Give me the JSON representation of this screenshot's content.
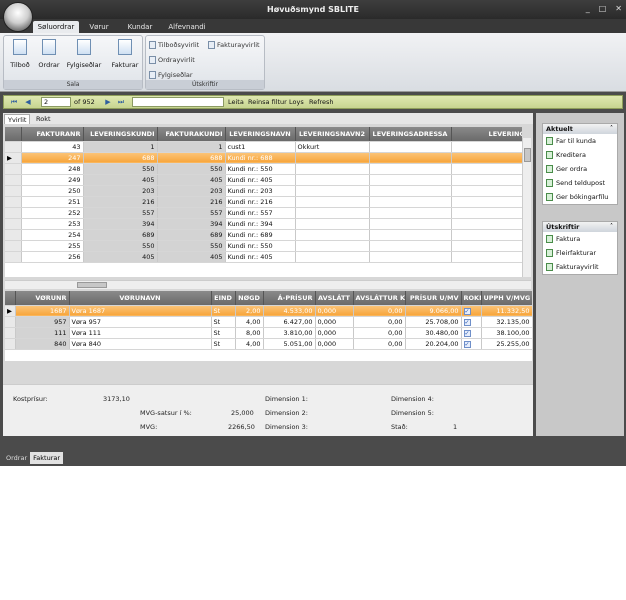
{
  "app": {
    "title": "Høvuðsmynd SBLITE",
    "window_buttons": [
      "_",
      "□",
      "✕"
    ]
  },
  "ribbon": {
    "tabs": [
      "Søluordrar",
      "Vørur",
      "Kundar",
      "Alfevnandi"
    ],
    "groups": {
      "sala": {
        "label": "Sala",
        "buttons": [
          "Tilboð",
          "Ordrar",
          "Fylgiseðlar",
          "Fakturar"
        ]
      },
      "utskriftir": {
        "label": "Útskriftir",
        "buttons": [
          "Tilboðsyvirlit",
          "Fakturayvirlit",
          "Ordrayvirlit",
          "Fylgiseðlar"
        ]
      }
    }
  },
  "navigator": {
    "current": "2",
    "of": "of 952",
    "leita": "Leita",
    "reinsa": "Reinsa filtur",
    "loys": "Loys",
    "refresh": "Refresh"
  },
  "subtabs": [
    "Yvirlit",
    "Rokt"
  ],
  "invoices": {
    "columns": [
      "FAKTURANR",
      "LEVERINGSKUNDI",
      "FAKTURAKUNDI",
      "LEVERINGSNAVN",
      "LEVERINGSNAVN2",
      "LEVERINGSADRESSA",
      "LEVERINGSADRESSA"
    ],
    "rows": [
      [
        "43",
        "1",
        "1",
        "cust1",
        "Okkurt",
        "",
        ""
      ],
      [
        "247",
        "688",
        "688",
        "Kundi nr.: 688",
        "",
        "",
        ""
      ],
      [
        "248",
        "550",
        "550",
        "Kundi nr.: 550",
        "",
        "",
        ""
      ],
      [
        "249",
        "405",
        "405",
        "Kundi nr.: 405",
        "",
        "",
        ""
      ],
      [
        "250",
        "203",
        "203",
        "Kundi nr.: 203",
        "",
        "",
        ""
      ],
      [
        "251",
        "216",
        "216",
        "Kundi nr.: 216",
        "",
        "",
        ""
      ],
      [
        "252",
        "557",
        "557",
        "Kundi nr.: 557",
        "",
        "",
        ""
      ],
      [
        "253",
        "394",
        "394",
        "Kundi nr.: 394",
        "",
        "",
        ""
      ],
      [
        "254",
        "689",
        "689",
        "Kundi nr.: 689",
        "",
        "",
        ""
      ],
      [
        "255",
        "550",
        "550",
        "Kundi nr.: 550",
        "",
        "",
        ""
      ],
      [
        "256",
        "405",
        "405",
        "Kundi nr.: 405",
        "",
        "",
        ""
      ]
    ]
  },
  "lines": {
    "columns": [
      "VØRUNR",
      "VØRUNAVN",
      "EIND",
      "NØGD",
      "Á-PRÍSUR",
      "AVSLÁTT",
      "AVSLÁTTUR K",
      "PRÍSUR U/MV",
      "ROKN",
      "UPPH V/MVG"
    ],
    "rows": [
      [
        "1687",
        "Vøra 1687",
        "St",
        "2,00",
        "4.533,00",
        "0,000",
        "0,00",
        "9.066,00",
        "✓",
        "11.332,50"
      ],
      [
        "957",
        "Vøra 957",
        "St",
        "4,00",
        "6.427,00",
        "0,000",
        "0,00",
        "25.708,00",
        "✓",
        "32.135,00"
      ],
      [
        "111",
        "Vøra 111",
        "St",
        "8,00",
        "3.810,00",
        "0,000",
        "0,00",
        "30.480,00",
        "✓",
        "38.100,00"
      ],
      [
        "840",
        "Vøra 840",
        "St",
        "4,00",
        "5.051,00",
        "0,000",
        "0,00",
        "20.204,00",
        "✓",
        "25.255,00"
      ]
    ]
  },
  "totals": {
    "kostprisur_label": "Kostprísur:",
    "kostprisur": "3173,10",
    "mvg_label": "MVG-satsur í %:",
    "mvg_rate": "25,000",
    "mvg": "MVG:",
    "mvg_value": "2266,50",
    "dim1": "Dimension 1:",
    "dim2": "Dimension 2:",
    "dim3": "Dimension 3:",
    "dim4": "Dimension 4:",
    "dim5": "Dimension 5:",
    "stad": "Stað:",
    "stad_value": "1"
  },
  "sidebar": {
    "aktuelt": {
      "title": "Aktuelt",
      "items": [
        "Far til kunda",
        "Kreditera",
        "Ger ordra",
        "Send teldupost",
        "Ger bókingarfílu"
      ]
    },
    "utskriftir": {
      "title": "Útskriftir",
      "items": [
        "Faktura",
        "Fleirfakturar",
        "Fakturayvirlit"
      ]
    }
  },
  "bottom_tabs": [
    "Ordrar",
    "Fakturar"
  ]
}
